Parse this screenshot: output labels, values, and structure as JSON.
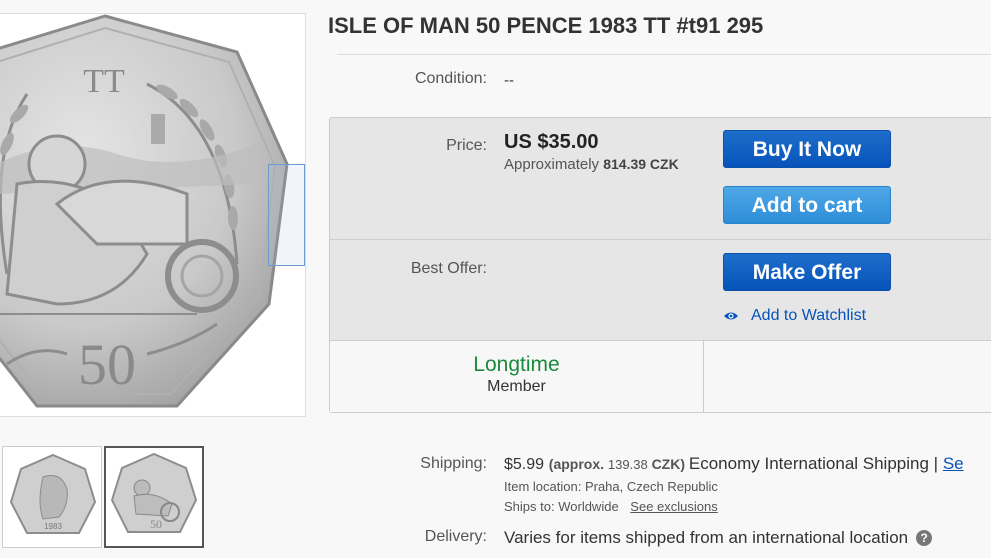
{
  "listing": {
    "title": "ISLE OF MAN 50 PENCE 1983 TT #t91 295",
    "coin_text": {
      "top": "TT",
      "denomination": "50"
    },
    "thumb_year": "1983"
  },
  "condition": {
    "label": "Condition:",
    "value": "--"
  },
  "price": {
    "label": "Price:",
    "amount": "US $35.00",
    "approx_prefix": "Approximately",
    "approx_value": "814.39 CZK"
  },
  "buttons": {
    "buy_now": "Buy It Now",
    "add_to_cart": "Add to cart",
    "make_offer": "Make Offer"
  },
  "best_offer": {
    "label": "Best Offer:"
  },
  "watchlist": {
    "label": "Add to Watchlist"
  },
  "seller": {
    "title": "Longtime",
    "subtitle": "Member"
  },
  "shipping": {
    "label": "Shipping:",
    "amount": "$5.99",
    "approx_open": "(approx.",
    "approx_value": "139.38",
    "approx_close": "CZK)",
    "service": "Economy International Shipping |",
    "link": "Se",
    "item_location_label": "Item location:",
    "item_location": "Praha, Czech Republic",
    "ships_to_label": "Ships to:",
    "ships_to": "Worldwide",
    "exclusions_link": "See exclusions"
  },
  "delivery": {
    "label": "Delivery:",
    "text": "Varies for items shipped from an international location",
    "help_icon": "?"
  },
  "colors": {
    "primary_button": "#0654ba",
    "secondary_button": "#2e8dd8",
    "member_green": "#1a8a3c",
    "link": "#0654ba"
  }
}
